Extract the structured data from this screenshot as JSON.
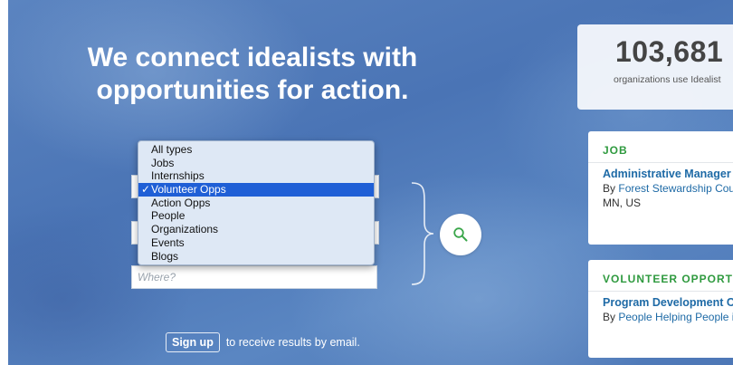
{
  "hero": {
    "headline_line1": "We connect idealists with",
    "headline_line2": "opportunities for action."
  },
  "search": {
    "type_dropdown": {
      "options": [
        "All types",
        "Jobs",
        "Internships",
        "Volunteer Opps",
        "Action Opps",
        "People",
        "Organizations",
        "Events",
        "Blogs"
      ],
      "selected": "Volunteer Opps",
      "check_mark": "✓"
    },
    "where_placeholder": "Where?"
  },
  "signup": {
    "button_label": "Sign up",
    "text": "to receive results by email."
  },
  "stats": {
    "count": "103,681",
    "caption": "organizations use Idealist"
  },
  "cards": [
    {
      "type": "JOB",
      "title": "Administrative Manager",
      "by_prefix": "By",
      "org": "Forest Stewardship Council",
      "location": "MN, US"
    },
    {
      "type": "VOLUNTEER OPPORTUNITY",
      "title": "Program Development Coordinator",
      "by_prefix": "By",
      "org": "People Helping People in"
    }
  ],
  "colors": {
    "hero_blue": "#4a74b5",
    "selection_blue": "#1f5fd6",
    "card_type_green": "#2f9a3f",
    "link_blue": "#1e6aa6",
    "search_icon_green": "#3aa64a"
  },
  "icons": {
    "search": "magnifier-icon",
    "chevron": "chevron-down-icon"
  }
}
